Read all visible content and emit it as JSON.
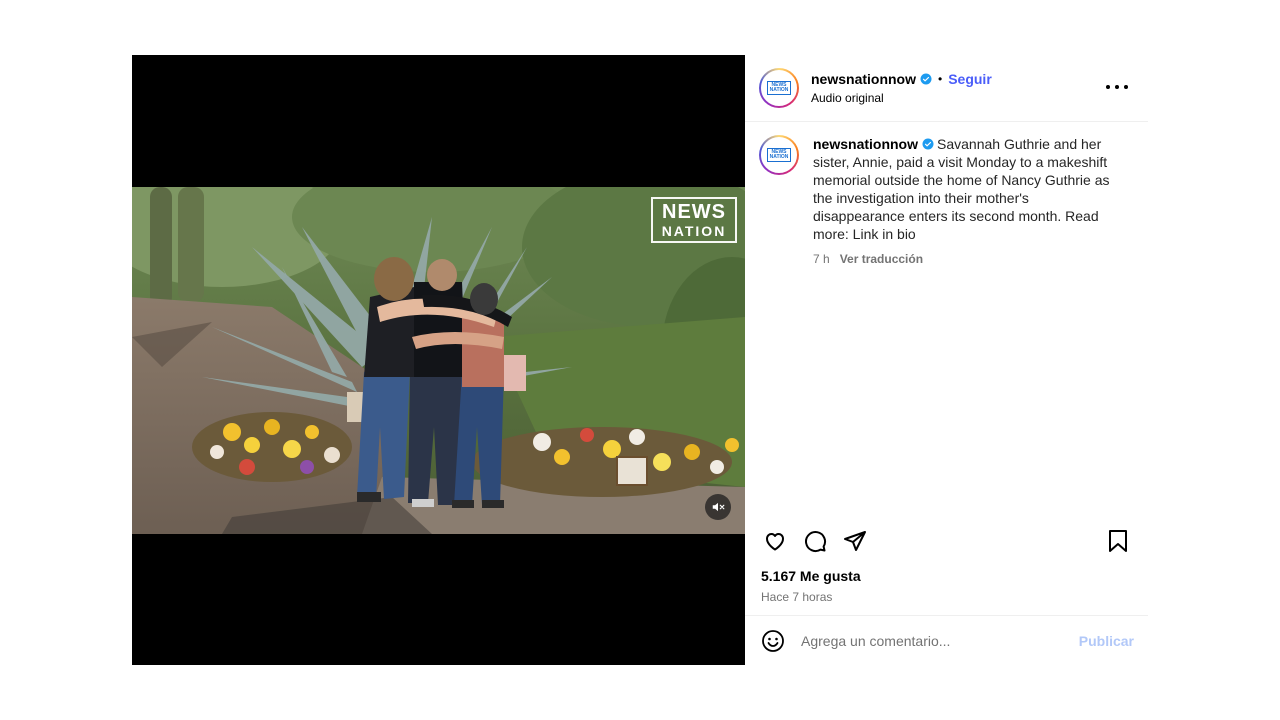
{
  "video": {
    "logo_line1": "NEWS",
    "logo_line2": "NATION",
    "mute_icon": "speaker-muted-icon"
  },
  "header": {
    "username": "newsnationnow",
    "separator": "•",
    "follow_label": "Seguir",
    "audio_label": "Audio original",
    "avatar_logo": "NEWS NATION"
  },
  "caption": {
    "username": "newsnationnow",
    "text": "Savannah Guthrie and her sister, Annie, paid a visit Monday to a makeshift memorial outside the home of Nancy Guthrie as the investigation into their mother's disappearance enters its second month. Read more: Link in bio",
    "age": "7 h",
    "translate_label": "Ver traducción"
  },
  "actions": {
    "icons": [
      "heart-icon",
      "comment-icon",
      "share-icon",
      "bookmark-icon"
    ]
  },
  "stats": {
    "likes": "5.167 Me gusta",
    "posted": "Hace 7 horas"
  },
  "comment": {
    "placeholder": "Agrega un comentario...",
    "publish_label": "Publicar"
  },
  "colors": {
    "accent": "#4a5df9",
    "verified": "#1d9bf0",
    "publish_disabled": "#b2c8f8",
    "muted_text": "#737373"
  }
}
